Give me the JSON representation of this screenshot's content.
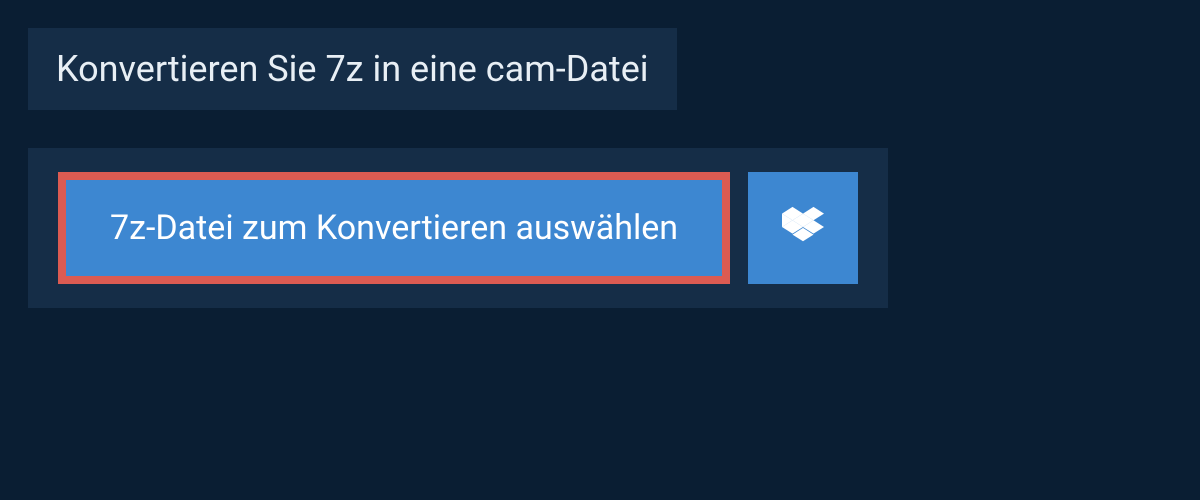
{
  "header": {
    "title": "Konvertieren Sie 7z in eine cam-Datei"
  },
  "actions": {
    "select_file_label": "7z-Datei zum Konvertieren auswählen"
  },
  "colors": {
    "page_bg": "#0a1e33",
    "panel_bg": "#152d47",
    "button_bg": "#3d87d1",
    "highlight_border": "#db5b52",
    "text_light": "#e8eff5",
    "text_white": "#ffffff"
  }
}
